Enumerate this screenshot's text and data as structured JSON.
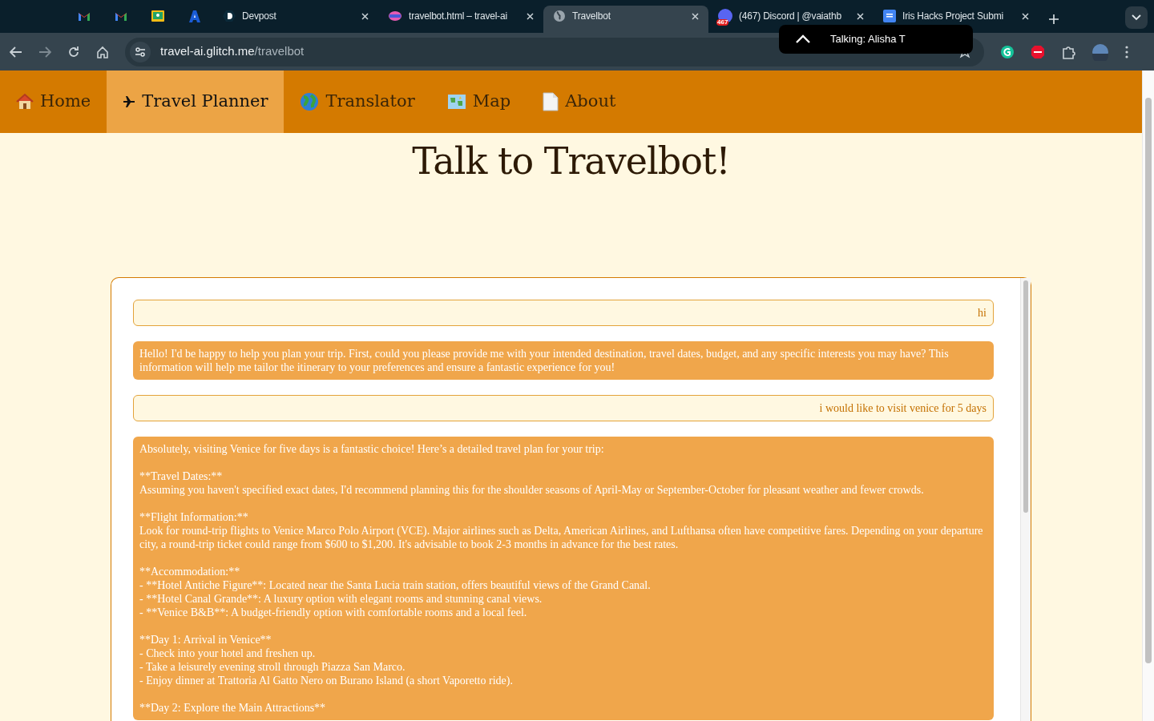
{
  "browser": {
    "tabs": [
      {
        "kind": "pinned",
        "selected": false
      },
      {
        "kind": "pinned",
        "selected": false
      },
      {
        "kind": "pinned",
        "selected": false
      },
      {
        "kind": "pinned",
        "selected": false
      },
      {
        "kind": "tab",
        "title": "Devpost",
        "selected": false
      },
      {
        "kind": "tab",
        "title": "travelbot.html – travel-ai",
        "selected": false
      },
      {
        "kind": "tab",
        "title": "Travelbot",
        "selected": true
      },
      {
        "kind": "tab",
        "title": "(467) Discord | @vaiathb",
        "selected": false,
        "badge": "467"
      },
      {
        "kind": "tab",
        "title": "Iris Hacks Project Submi",
        "selected": false
      }
    ],
    "url_host": "travel-ai.glitch.me",
    "url_path": "/travelbot",
    "tooltip": "Talking: Alisha T"
  },
  "nav": [
    {
      "label": "Home",
      "selected": false
    },
    {
      "label": "Travel Planner",
      "selected": true
    },
    {
      "label": "Translator",
      "selected": false
    },
    {
      "label": "Map",
      "selected": false
    },
    {
      "label": "About",
      "selected": false
    }
  ],
  "heading": "Talk to Travelbot!",
  "messages": [
    {
      "kind": "user",
      "blocks": [
        [
          "hi"
        ]
      ]
    },
    {
      "kind": "bot",
      "blocks": [
        [
          "Hello! I'd be happy to help you plan your trip. First, could you please provide me with your intended destination, travel dates, budget, and any specific interests you may have? This information will help me tailor the itinerary to your preferences and ensure a fantastic experience for you!"
        ]
      ]
    },
    {
      "kind": "user",
      "blocks": [
        [
          "i would like to visit venice for 5 days"
        ]
      ]
    },
    {
      "kind": "bot",
      "blocks": [
        [
          "Absolutely, visiting Venice for five days is a fantastic choice! Here’s a detailed travel plan for your trip:"
        ],
        [
          "**Travel Dates:**",
          "Assuming you haven't specified exact dates, I'd recommend planning this for the shoulder seasons of April-May or September-October for pleasant weather and fewer crowds."
        ],
        [
          "**Flight Information:**",
          "Look for round-trip flights to Venice Marco Polo Airport (VCE). Major airlines such as Delta, American Airlines, and Lufthansa often have competitive fares. Depending on your departure city, a round-trip ticket could range from $600 to $1,200. It's advisable to book 2-3 months in advance for the best rates."
        ],
        [
          "**Accommodation:**",
          "- **Hotel Antiche Figure**: Located near the Santa Lucia train station, offers beautiful views of the Grand Canal.",
          "- **Hotel Canal Grande**: A luxury option with elegant rooms and stunning canal views.",
          "- **Venice B&B**: A budget-friendly option with comfortable rooms and a local feel."
        ],
        [
          "**Day 1: Arrival in Venice**",
          "- Check into your hotel and freshen up.",
          "- Take a leisurely evening stroll through Piazza San Marco.",
          "- Enjoy dinner at Trattoria Al Gatto Nero on Burano Island (a short Vaporetto ride)."
        ],
        [
          "**Day 2: Explore the Main Attractions**"
        ]
      ]
    }
  ]
}
